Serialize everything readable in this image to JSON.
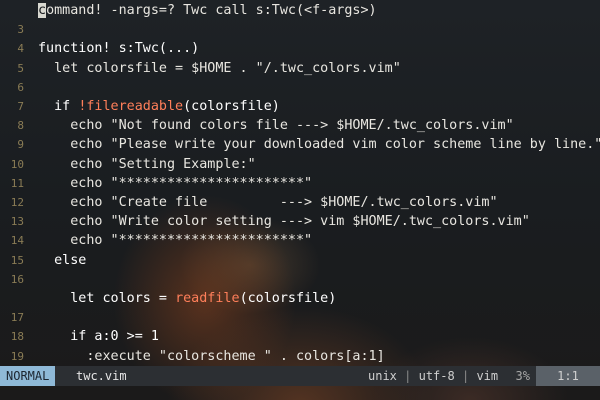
{
  "editor": {
    "lines": [
      {
        "num": "",
        "segs": [
          {
            "t": "c",
            "cls": "cursor"
          },
          {
            "t": "ommand! -nargs=? Twc call s:Twc(<f-args>)",
            "cls": "cmd"
          }
        ]
      },
      {
        "num": "3",
        "segs": []
      },
      {
        "num": "4",
        "segs": [
          {
            "t": "function! s:Twc(...)",
            "cls": "kw"
          }
        ]
      },
      {
        "num": "5",
        "segs": [
          {
            "t": "  let colorsfile = $HOME . \"/.twc_colors.vim\"",
            "cls": "str"
          }
        ]
      },
      {
        "num": "6",
        "segs": []
      },
      {
        "num": "7",
        "segs": [
          {
            "t": "  if ",
            "cls": "kw"
          },
          {
            "t": "!",
            "cls": "bang"
          },
          {
            "t": "filereadable",
            "cls": "fn"
          },
          {
            "t": "(colorsfile)",
            "cls": "kw"
          }
        ]
      },
      {
        "num": "8",
        "segs": [
          {
            "t": "    echo \"Not found colors file ---> $HOME/.twc_colors.vim\"",
            "cls": "str"
          }
        ]
      },
      {
        "num": "9",
        "segs": [
          {
            "t": "    echo \"Please write your downloaded vim color scheme line by line.\"",
            "cls": "str"
          }
        ]
      },
      {
        "num": "10",
        "segs": [
          {
            "t": "    echo \"Setting Example:\"",
            "cls": "str"
          }
        ]
      },
      {
        "num": "11",
        "segs": [
          {
            "t": "    echo \"***********************\"",
            "cls": "str"
          }
        ]
      },
      {
        "num": "12",
        "segs": [
          {
            "t": "    echo \"Create file         ---> $HOME/.twc_colors.vim\"",
            "cls": "str"
          }
        ]
      },
      {
        "num": "13",
        "segs": [
          {
            "t": "    echo \"Write color setting ---> vim $HOME/.twc_colors.vim\"",
            "cls": "str"
          }
        ]
      },
      {
        "num": "14",
        "segs": [
          {
            "t": "    echo \"***********************\"",
            "cls": "str"
          }
        ]
      },
      {
        "num": "15",
        "segs": [
          {
            "t": "  else",
            "cls": "kw"
          }
        ]
      },
      {
        "num": "16",
        "segs": []
      },
      {
        "num": "",
        "segs": [
          {
            "t": "    let colors = ",
            "cls": "kw"
          },
          {
            "t": "readfile",
            "cls": "fn"
          },
          {
            "t": "(colorsfile)",
            "cls": "kw"
          }
        ]
      },
      {
        "num": "17",
        "segs": []
      },
      {
        "num": "18",
        "segs": [
          {
            "t": "    if a:0 >= 1",
            "cls": "kw"
          }
        ]
      },
      {
        "num": "19",
        "segs": [
          {
            "t": "      :execute \"colorscheme \" . colors[a:1]",
            "cls": "str"
          }
        ]
      }
    ]
  },
  "statusbar": {
    "mode": "NORMAL",
    "filename": "twc.vim",
    "format": "unix",
    "encoding": "utf-8",
    "filetype": "vim",
    "separator": "|",
    "percent": "3%",
    "position": "1:1"
  },
  "colors": {
    "mode_bg": "#8fb9d7",
    "function_name": "#ff7f5a",
    "text": "#e8e6e0",
    "line_number": "#8a7c55"
  }
}
